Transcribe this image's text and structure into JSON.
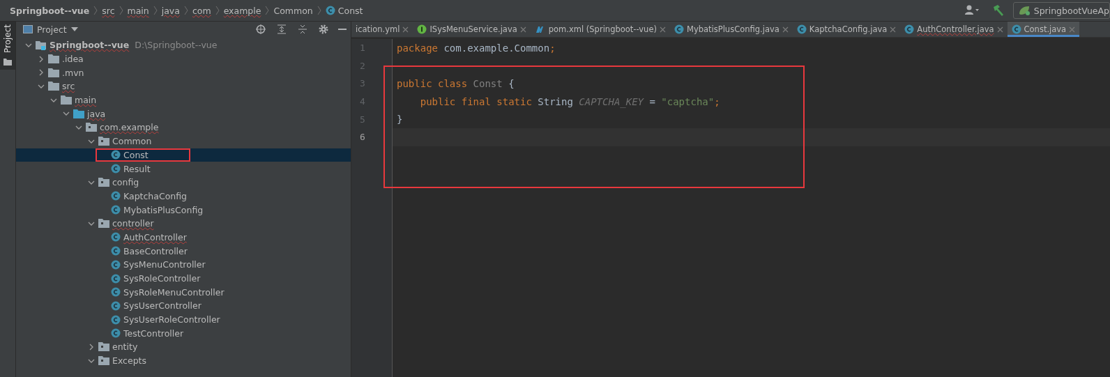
{
  "breadcrumb": [
    {
      "label": "Springboot--vue",
      "kind": "project",
      "squiggle": false
    },
    {
      "label": "src",
      "kind": "dir",
      "squiggle": true
    },
    {
      "label": "main",
      "kind": "dir",
      "squiggle": true
    },
    {
      "label": "java",
      "kind": "dir",
      "squiggle": true
    },
    {
      "label": "com",
      "kind": "dir",
      "squiggle": true
    },
    {
      "label": "example",
      "kind": "dir",
      "squiggle": true
    },
    {
      "label": "Common",
      "kind": "dir",
      "squiggle": false
    },
    {
      "label": "Const",
      "kind": "class",
      "squiggle": false
    }
  ],
  "toolbar": {
    "run_config": "SpringbootVueAp"
  },
  "side_stripe": {
    "tab": "Project"
  },
  "project_panel": {
    "title": "Project",
    "tree": [
      {
        "label": "Springboot--vue",
        "path": "D:\\Springboot--vue",
        "kind": "module",
        "expanded": true,
        "selected": false,
        "squiggle": true,
        "highlight": false,
        "children": [
          {
            "label": ".idea",
            "kind": "folder",
            "expanded": false,
            "selected": false,
            "squiggle": false,
            "highlight": false
          },
          {
            "label": ".mvn",
            "kind": "folder",
            "expanded": false,
            "selected": false,
            "squiggle": false,
            "highlight": false
          },
          {
            "label": "src",
            "kind": "folder",
            "expanded": true,
            "selected": false,
            "squiggle": true,
            "highlight": false,
            "children": [
              {
                "label": "main",
                "kind": "folder",
                "expanded": true,
                "selected": false,
                "squiggle": true,
                "highlight": false,
                "children": [
                  {
                    "label": "java",
                    "kind": "source",
                    "expanded": true,
                    "selected": false,
                    "squiggle": true,
                    "highlight": false,
                    "children": [
                      {
                        "label": "com.example",
                        "kind": "package",
                        "expanded": true,
                        "selected": false,
                        "squiggle": true,
                        "highlight": false,
                        "children": [
                          {
                            "label": "Common",
                            "kind": "package",
                            "expanded": true,
                            "selected": false,
                            "squiggle": false,
                            "highlight": false,
                            "children": [
                              {
                                "label": "Const",
                                "kind": "class",
                                "selected": true,
                                "squiggle": false,
                                "highlight": true
                              },
                              {
                                "label": "Result",
                                "kind": "class",
                                "selected": false,
                                "squiggle": false,
                                "highlight": false
                              }
                            ]
                          },
                          {
                            "label": "config",
                            "kind": "package",
                            "expanded": true,
                            "selected": false,
                            "squiggle": false,
                            "highlight": false,
                            "children": [
                              {
                                "label": "KaptchaConfig",
                                "kind": "class",
                                "selected": false,
                                "squiggle": false,
                                "highlight": false
                              },
                              {
                                "label": "MybatisPlusConfig",
                                "kind": "class",
                                "selected": false,
                                "squiggle": false,
                                "highlight": false
                              }
                            ]
                          },
                          {
                            "label": "controller",
                            "kind": "package",
                            "expanded": true,
                            "selected": false,
                            "squiggle": true,
                            "highlight": false,
                            "children": [
                              {
                                "label": "AuthController",
                                "kind": "class",
                                "selected": false,
                                "squiggle": true,
                                "highlight": false
                              },
                              {
                                "label": "BaseController",
                                "kind": "class",
                                "selected": false,
                                "squiggle": false,
                                "highlight": false
                              },
                              {
                                "label": "SysMenuController",
                                "kind": "class",
                                "selected": false,
                                "squiggle": false,
                                "highlight": false
                              },
                              {
                                "label": "SysRoleController",
                                "kind": "class",
                                "selected": false,
                                "squiggle": false,
                                "highlight": false
                              },
                              {
                                "label": "SysRoleMenuController",
                                "kind": "class",
                                "selected": false,
                                "squiggle": false,
                                "highlight": false
                              },
                              {
                                "label": "SysUserController",
                                "kind": "class",
                                "selected": false,
                                "squiggle": false,
                                "highlight": false
                              },
                              {
                                "label": "SysUserRoleController",
                                "kind": "class",
                                "selected": false,
                                "squiggle": false,
                                "highlight": false
                              },
                              {
                                "label": "TestController",
                                "kind": "class",
                                "selected": false,
                                "squiggle": false,
                                "highlight": false
                              }
                            ]
                          },
                          {
                            "label": "entity",
                            "kind": "package",
                            "expanded": false,
                            "selected": false,
                            "squiggle": false,
                            "highlight": false
                          },
                          {
                            "label": "Excepts",
                            "kind": "package",
                            "expanded": true,
                            "selected": false,
                            "squiggle": false,
                            "highlight": false
                          }
                        ]
                      }
                    ]
                  }
                ]
              }
            ]
          }
        ]
      }
    ]
  },
  "tabs": [
    {
      "label": "ication.yml",
      "kind": "yaml",
      "selected": false,
      "squiggle": false
    },
    {
      "label": "ISysMenuService.java",
      "kind": "interface",
      "selected": false,
      "squiggle": false
    },
    {
      "label": "pom.xml (Springboot--vue)",
      "kind": "maven",
      "selected": false,
      "squiggle": false
    },
    {
      "label": "MybatisPlusConfig.java",
      "kind": "class",
      "selected": false,
      "squiggle": false
    },
    {
      "label": "KaptchaConfig.java",
      "kind": "class",
      "selected": false,
      "squiggle": false
    },
    {
      "label": "AuthController.java",
      "kind": "class",
      "selected": false,
      "squiggle": true
    },
    {
      "label": "Const.java",
      "kind": "class",
      "selected": true,
      "squiggle": false
    }
  ],
  "editor": {
    "annotation_box": true,
    "lines": [
      {
        "number": "1",
        "current": false,
        "tokens": [
          {
            "text": "package ",
            "kind": "keyword"
          },
          {
            "text": "com.example.Common",
            "kind": "plain"
          },
          {
            "text": ";",
            "kind": "keyword"
          }
        ]
      },
      {
        "number": "2",
        "current": false
      },
      {
        "number": "3",
        "current": false,
        "tokens": [
          {
            "text": "public class ",
            "kind": "keyword"
          },
          {
            "text": "Const ",
            "kind": "unused"
          },
          {
            "text": "{",
            "kind": "plain"
          }
        ]
      },
      {
        "number": "4",
        "current": false,
        "tokens": [
          {
            "text": "    public final static ",
            "kind": "keyword"
          },
          {
            "text": "String ",
            "kind": "plain"
          },
          {
            "text": "CAPTCHA_KEY",
            "kind": "constant"
          },
          {
            "text": " = ",
            "kind": "plain"
          },
          {
            "text": "\"captcha\"",
            "kind": "string"
          },
          {
            "text": ";",
            "kind": "keyword"
          }
        ]
      },
      {
        "number": "5",
        "current": false,
        "tokens": [
          {
            "text": "}",
            "kind": "plain"
          }
        ]
      },
      {
        "number": "6",
        "current": true
      }
    ]
  }
}
